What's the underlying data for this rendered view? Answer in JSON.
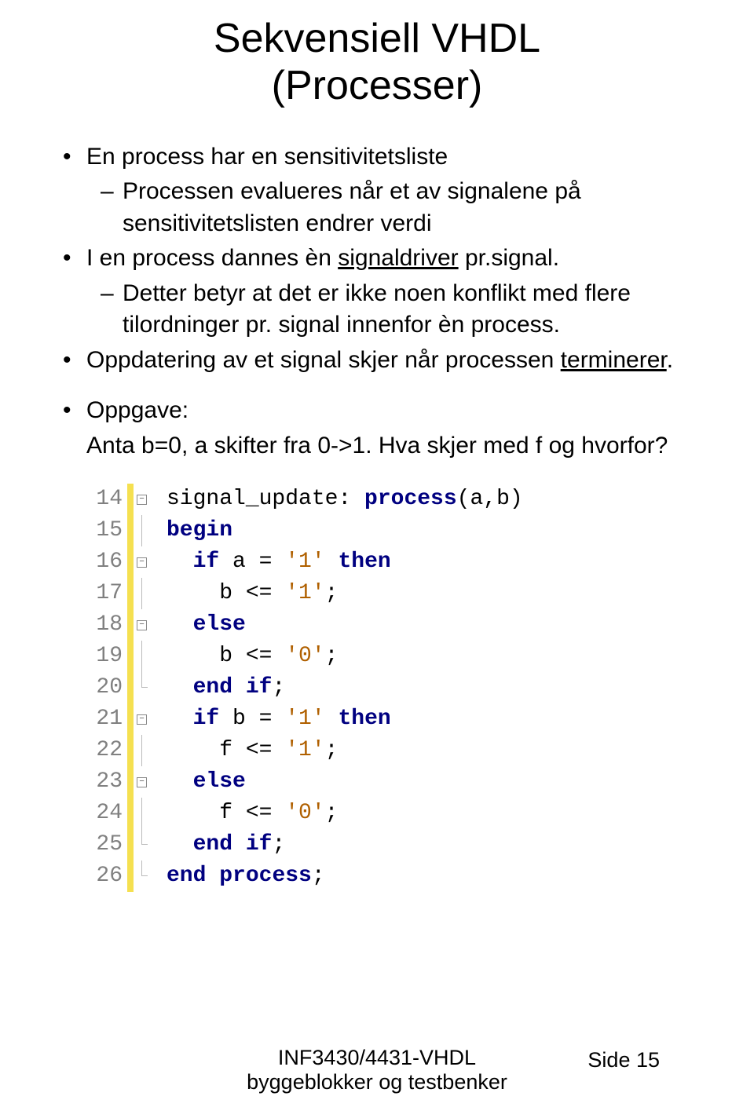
{
  "title_line1": "Sekvensiell VHDL",
  "title_line2": "(Processer)",
  "bullets": {
    "b1": "En process har en sensitivitetsliste",
    "b1_sub1": "Processen evalueres når et av signalene på sensitivitetslisten endrer verdi",
    "b2_a": "I en process dannes èn ",
    "b2_u": "signaldriver",
    "b2_b": " pr.signal.",
    "b2_sub1": "Detter betyr at det er ikke noen konflikt med flere tilordninger pr. signal innenfor èn process.",
    "b3_a": "Oppdatering av et signal skjer når processen ",
    "b3_u": "terminerer",
    "b3_b": ".",
    "b4": "Oppgave:",
    "b4_text": "Anta b=0, a skifter fra 0->1. Hva skjer med f og hvorfor?"
  },
  "code": {
    "l14": {
      "num": "14",
      "pre": "signal_update: ",
      "kw": "process",
      "post": "(a,b)"
    },
    "l15": {
      "num": "15",
      "kw": "begin"
    },
    "l16": {
      "num": "16",
      "kw1": "if",
      "mid": " a = ",
      "lit": "'1'",
      "sp": " ",
      "kw2": "then"
    },
    "l17": {
      "num": "17",
      "pre": "    b <= ",
      "lit": "'1'",
      "post": ";"
    },
    "l18": {
      "num": "18",
      "kw": "else"
    },
    "l19": {
      "num": "19",
      "pre": "    b <= ",
      "lit": "'0'",
      "post": ";"
    },
    "l20": {
      "num": "20",
      "kw1": "end",
      "sp": " ",
      "kw2": "if",
      "post": ";"
    },
    "l21": {
      "num": "21",
      "kw1": "if",
      "mid": " b = ",
      "lit": "'1'",
      "sp": " ",
      "kw2": "then"
    },
    "l22": {
      "num": "22",
      "pre": "    f <= ",
      "lit": "'1'",
      "post": ";"
    },
    "l23": {
      "num": "23",
      "kw": "else"
    },
    "l24": {
      "num": "24",
      "pre": "    f <= ",
      "lit": "'0'",
      "post": ";"
    },
    "l25": {
      "num": "25",
      "kw1": "end",
      "sp": " ",
      "kw2": "if",
      "post": ";"
    },
    "l26": {
      "num": "26",
      "kw1": "end",
      "sp": " ",
      "kw2": "process",
      "post": ";"
    }
  },
  "footer_line1": "INF3430/4431-VHDL",
  "footer_line2": "byggeblokker og testbenker",
  "page_number": "Side 15"
}
